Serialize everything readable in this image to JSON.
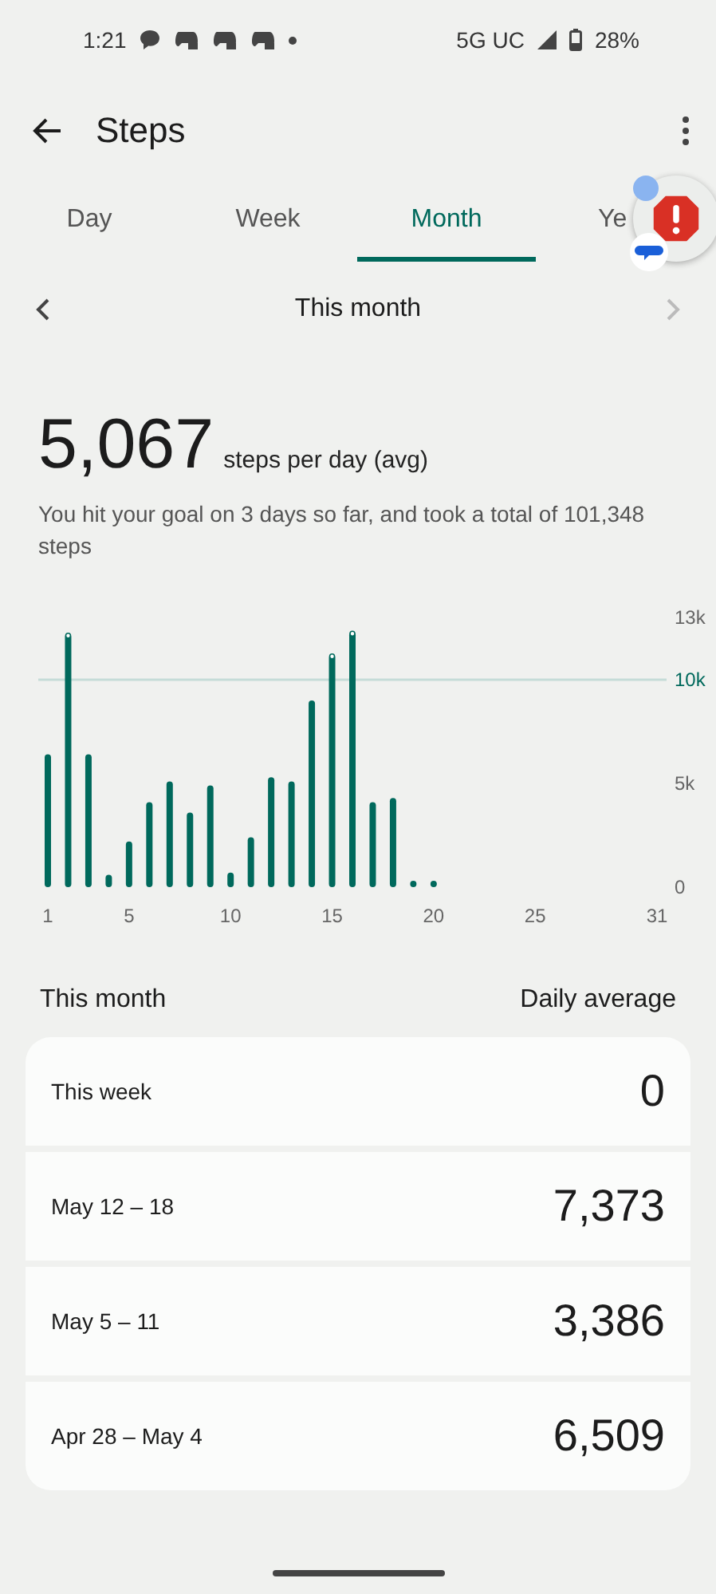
{
  "status_bar": {
    "time": "1:21",
    "network": "5G UC",
    "battery": "28%"
  },
  "app_bar": {
    "title": "Steps"
  },
  "tabs": [
    {
      "label": "Day",
      "selected": false
    },
    {
      "label": "Week",
      "selected": false
    },
    {
      "label": "Month",
      "selected": true
    },
    {
      "label": "Ye",
      "selected": false
    }
  ],
  "period": {
    "label": "This month",
    "next_disabled": true
  },
  "summary": {
    "value": "5,067",
    "unit": "steps per day (avg)",
    "description": "You hit your goal on 3 days so far, and took a total of 101,348 steps"
  },
  "chart_data": {
    "type": "bar",
    "x": [
      1,
      2,
      3,
      4,
      5,
      6,
      7,
      8,
      9,
      10,
      11,
      12,
      13,
      14,
      15,
      16,
      17,
      18,
      19,
      20
    ],
    "series": [
      {
        "color": "#00695c",
        "values": [
          6400,
          12200,
          6400,
          600,
          2200,
          4100,
          5100,
          3600,
          4900,
          700,
          2400,
          5300,
          5100,
          9000,
          11200,
          12300,
          4100,
          4300,
          0,
          0
        ]
      }
    ],
    "xlim": [
      1,
      31
    ],
    "ylim": [
      0,
      13000
    ],
    "yticks": [
      {
        "value": 0,
        "label": "0"
      },
      {
        "value": 5000,
        "label": "5k"
      },
      {
        "value": 10000,
        "label": "10k"
      },
      {
        "value": 13000,
        "label": "13k"
      }
    ],
    "xticks": [
      1,
      5,
      10,
      15,
      20,
      25,
      31
    ],
    "ref_lines": [
      {
        "axis": "y",
        "value": 10000
      }
    ]
  },
  "list_header": {
    "left": "This month",
    "right": "Daily average"
  },
  "weeks": [
    {
      "label": "This week",
      "value": "0"
    },
    {
      "label": "May 12 – 18",
      "value": "7,373"
    },
    {
      "label": "May 5 – 11",
      "value": "3,386"
    },
    {
      "label": "Apr 28 – May 4",
      "value": "6,509"
    }
  ]
}
